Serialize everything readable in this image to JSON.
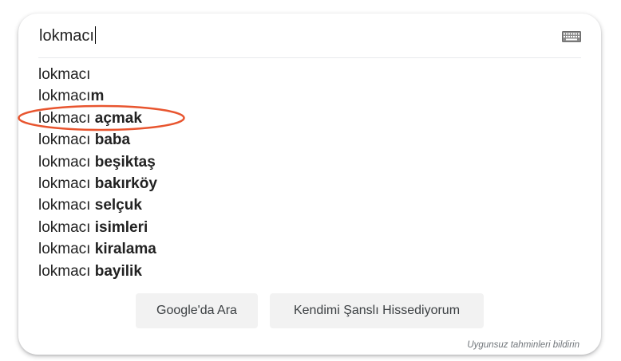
{
  "search": {
    "query": "lokmacı"
  },
  "icons": {
    "keyboard": "keyboard-icon"
  },
  "suggestions": [
    {
      "prefix": "lokmacı",
      "completion": ""
    },
    {
      "prefix": "lokmacı",
      "completion": "m"
    },
    {
      "prefix": "lokmacı ",
      "completion": "açmak"
    },
    {
      "prefix": "lokmacı ",
      "completion": "baba"
    },
    {
      "prefix": "lokmacı ",
      "completion": "beşiktaş"
    },
    {
      "prefix": "lokmacı ",
      "completion": "bakırköy"
    },
    {
      "prefix": "lokmacı ",
      "completion": "selçuk"
    },
    {
      "prefix": "lokmacı ",
      "completion": "isimleri"
    },
    {
      "prefix": "lokmacı ",
      "completion": "kiralama"
    },
    {
      "prefix": "lokmacı ",
      "completion": "bayilik"
    }
  ],
  "buttons": {
    "search_label": "Google'da Ara",
    "lucky_label": "Kendimi Şanslı Hissediyorum"
  },
  "footer": {
    "report_label": "Uygunsuz tahminleri bildirin"
  },
  "colors": {
    "highlight": "#e8552f",
    "text": "#222222",
    "button_bg": "#f2f2f2"
  }
}
